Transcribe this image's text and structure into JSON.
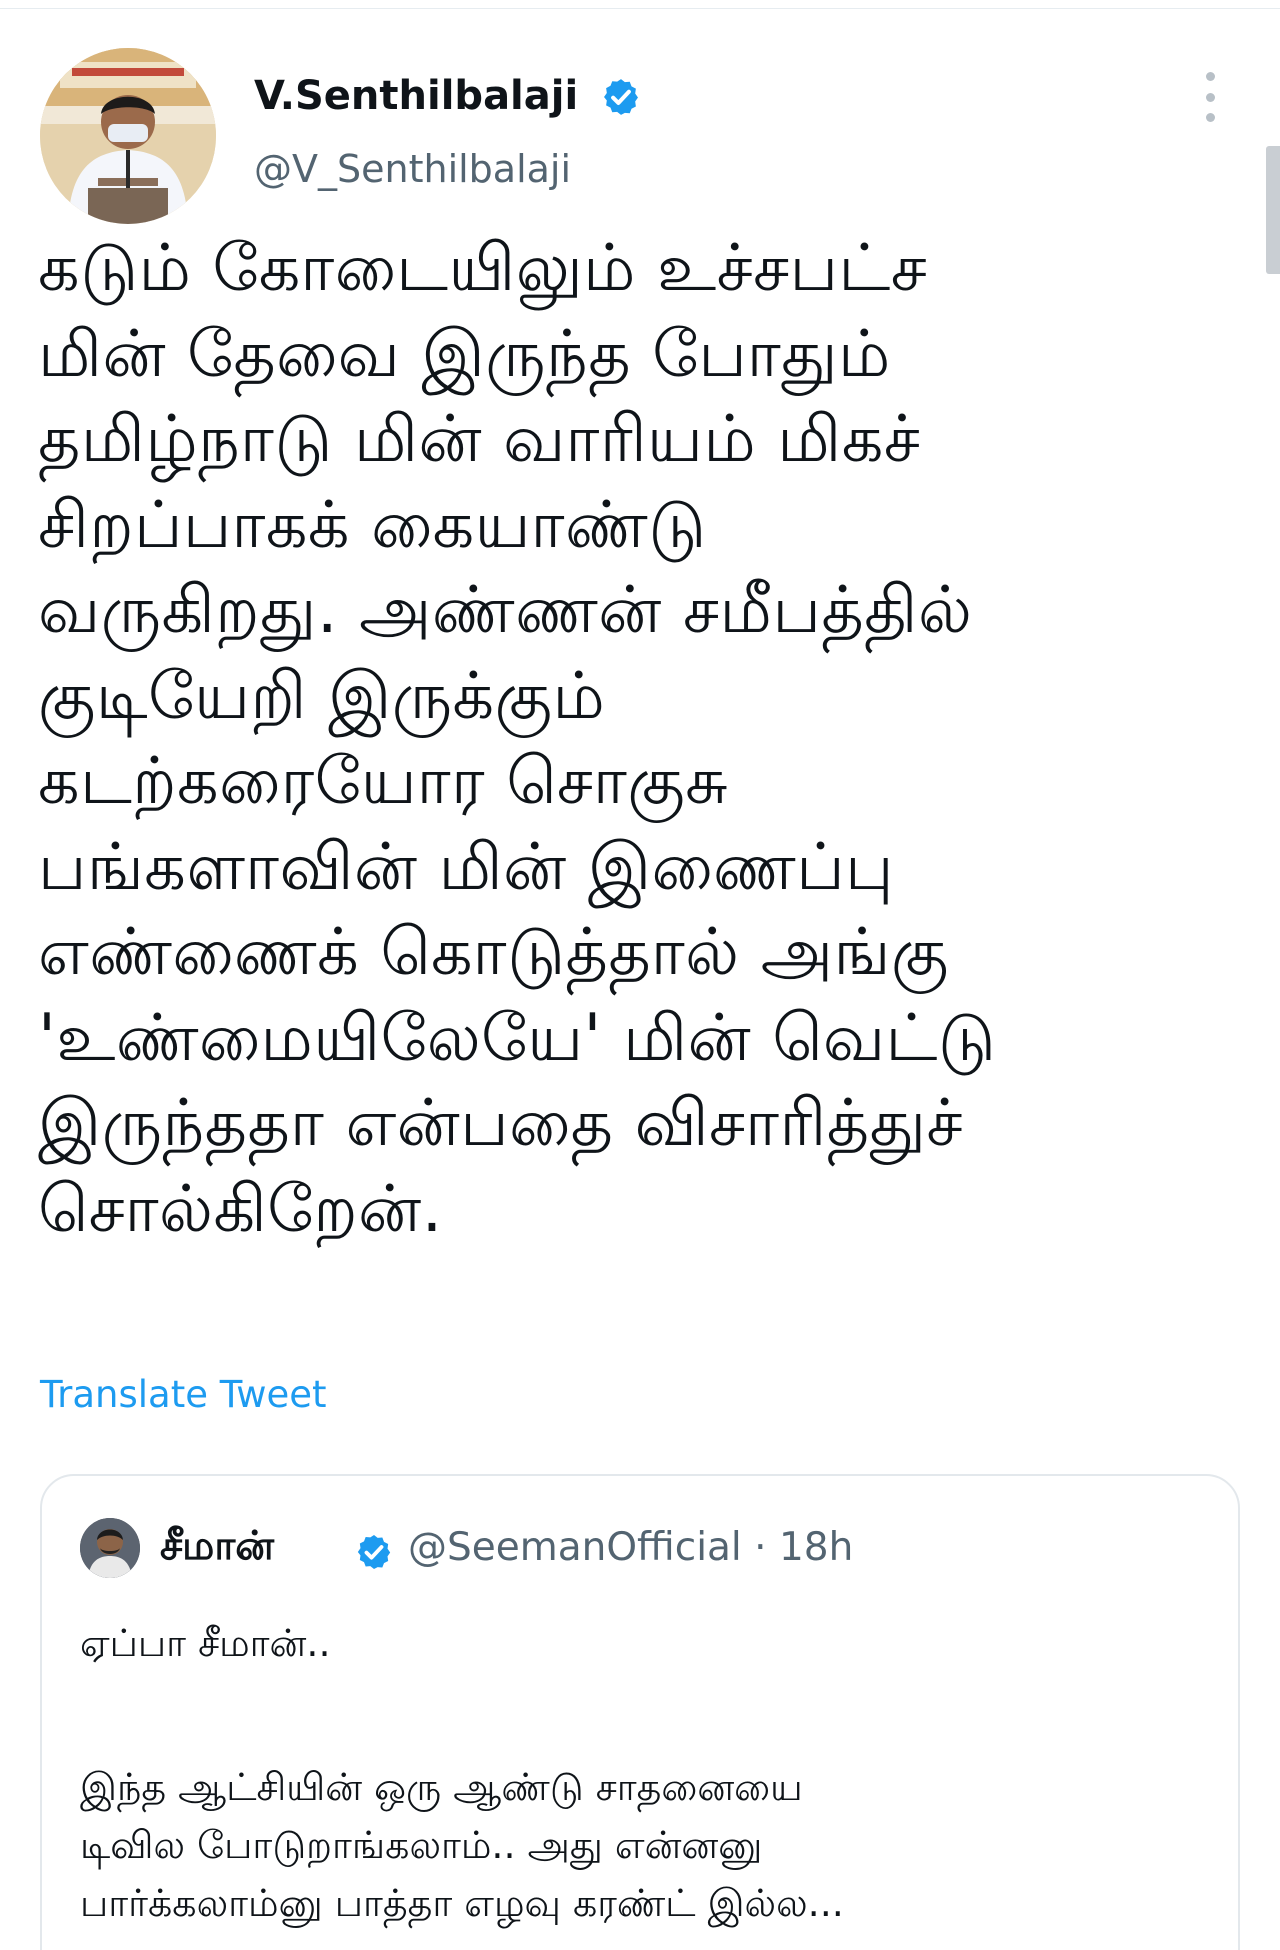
{
  "colors": {
    "text": "#0f1419",
    "secondary_text": "#536471",
    "link": "#1d9bf0",
    "verified": "#1d9bf0",
    "border": "#e3e8ec"
  },
  "tweet": {
    "author": {
      "display_name": "V.Senthilbalaji",
      "handle": "@V_Senthilbalaji",
      "verified_icon": "verified-badge-icon",
      "avatar_icon": "profile-photo"
    },
    "more_icon": "vertical-ellipsis-icon",
    "body_lines": [
      "கடும் கோடையிலும் உச்சபட்ச",
      "மின் தேவை இருந்த போதும்",
      "தமிழ்நாடு மின் வாரியம் மிகச்",
      "சிறப்பாகக் கையாண்டு",
      "வருகிறது. அண்ணன் சமீபத்தில்",
      "குடியேறி இருக்கும்",
      "கடற்கரையோர சொகுசு",
      "பங்களாவின் மின் இணைப்பு",
      "எண்ணைக் கொடுத்தால் அங்கு",
      "'உண்மையிலேயே' மின் வெட்டு",
      "இருந்ததா என்பதை விசாரித்துச்",
      "சொல்கிறேன்."
    ],
    "translate_label": "Translate Tweet"
  },
  "quoted_tweet": {
    "display_name": "சீமான்",
    "handle_and_time": "@SeemanOfficial · 18h",
    "verified_icon": "verified-badge-icon",
    "first_line": "ஏப்பா சீமான்..",
    "body_lines": [
      "இந்த ஆட்சியின் ஒரு ஆண்டு சாதனையை",
      "டிவில போடுறாங்கலாம்.. அது என்னனு",
      "பார்க்கலாம்னு பாத்தா எழவு கரண்ட் இல்ல..."
    ]
  }
}
